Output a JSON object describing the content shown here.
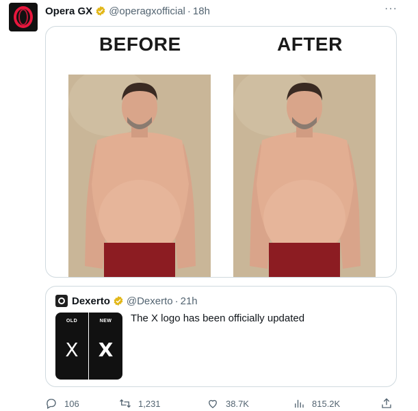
{
  "tweet": {
    "author": "Opera GX",
    "handle": "@operagxofficial",
    "separator": "·",
    "time": "18h",
    "more": "···"
  },
  "media": {
    "before_label": "BEFORE",
    "after_label": "AFTER"
  },
  "quoted": {
    "author": "Dexerto",
    "handle": "@Dexerto",
    "separator": "·",
    "time": "21h",
    "text": "The X logo has been officially updated",
    "old_tag": "OLD",
    "new_tag": "NEW",
    "logo_char": "X"
  },
  "actions": {
    "replies": "106",
    "retweets": "1,231",
    "likes": "38.7K",
    "views": "815.2K"
  },
  "colors": {
    "accent_red": "#e8173d",
    "verified_gold": "#e2b719",
    "muted": "#536471"
  }
}
